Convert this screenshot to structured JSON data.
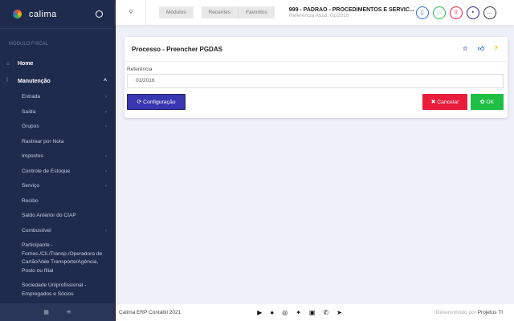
{
  "sidebar": {
    "app_name": "calima",
    "section": "MÓDULO FISCAL",
    "home": "Home",
    "maintenance": "Manutenção",
    "items": [
      {
        "label": "Entrada",
        "sub": true
      },
      {
        "label": "Saída",
        "sub": true
      },
      {
        "label": "Grupos",
        "sub": true
      },
      {
        "label": "Rastrear por Nota",
        "sub": false
      },
      {
        "label": "Impostos",
        "sub": true
      },
      {
        "label": "Controle de Estoque",
        "sub": true
      },
      {
        "label": "Serviço",
        "sub": true
      },
      {
        "label": "Recibo",
        "sub": false
      },
      {
        "label": "Saldo Anterior do CIAP",
        "sub": false
      },
      {
        "label": "Combustível",
        "sub": true
      },
      {
        "label": "Participante - Fornec./Cli./Transp./Operadora de Cartão/Vale Transporte/Agência, Posto ou filial",
        "sub": false
      },
      {
        "label": "Sociedade Uniprofissional - Empregados e Sócios",
        "sub": false
      }
    ]
  },
  "header": {
    "modules": "Módulos",
    "recent": "Recentes",
    "favorites": "Favoritos",
    "company": "999 - PADRAO - PROCEDIMENTOS E SERVIC...",
    "reference": "Referência Atual: 01/2016"
  },
  "card": {
    "title": "Processo - Preencher PGDAS",
    "ref_label": "Referência",
    "ref_value": "01/2016",
    "config": "Configuração",
    "cancel": "Cancelar",
    "ok": "OK"
  },
  "footer": {
    "copyright": "Calima ERP Contábil 2021",
    "dev_prefix": "Desenvolvido por",
    "dev_name": "Projetus TI"
  },
  "colors": {
    "sidebar": "#1f2b4d",
    "primary": "#3a35b0",
    "danger": "#ea1c3c",
    "success": "#1fbf45"
  }
}
